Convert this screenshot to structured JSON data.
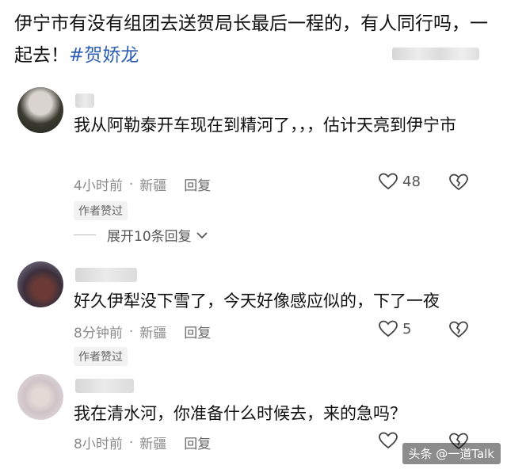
{
  "post": {
    "text_main": "伊宁市有没有组团去送贺局长最后一程的，有人同行吗，一起去！",
    "hashtag": "#贺娇龙"
  },
  "comments": [
    {
      "text": "我从阿勒泰开车现在到精河了，，，估计天亮到伊宁市",
      "time": "4小时前",
      "location": "新疆",
      "reply_label": "回复",
      "likes": "48",
      "badge": "作者赞过",
      "expand_label": "展开10条回复"
    },
    {
      "text": "好久伊犁没下雪了，今天好像感应似的，下了一夜",
      "time": "8分钟前",
      "location": "新疆",
      "reply_label": "回复",
      "likes": "5",
      "badge": "作者赞过"
    },
    {
      "text": "我在清水河，你准备什么时候去，来的急吗？",
      "time": "8小时前",
      "location": "新疆",
      "reply_label": "回复"
    }
  ],
  "watermark": "头条 @一道Talk",
  "colors": {
    "hashtag": "#2f5fb3",
    "meta": "#8a8a8a"
  },
  "icons": [
    "heart-icon",
    "broken-heart-icon",
    "chevron-down-icon"
  ]
}
